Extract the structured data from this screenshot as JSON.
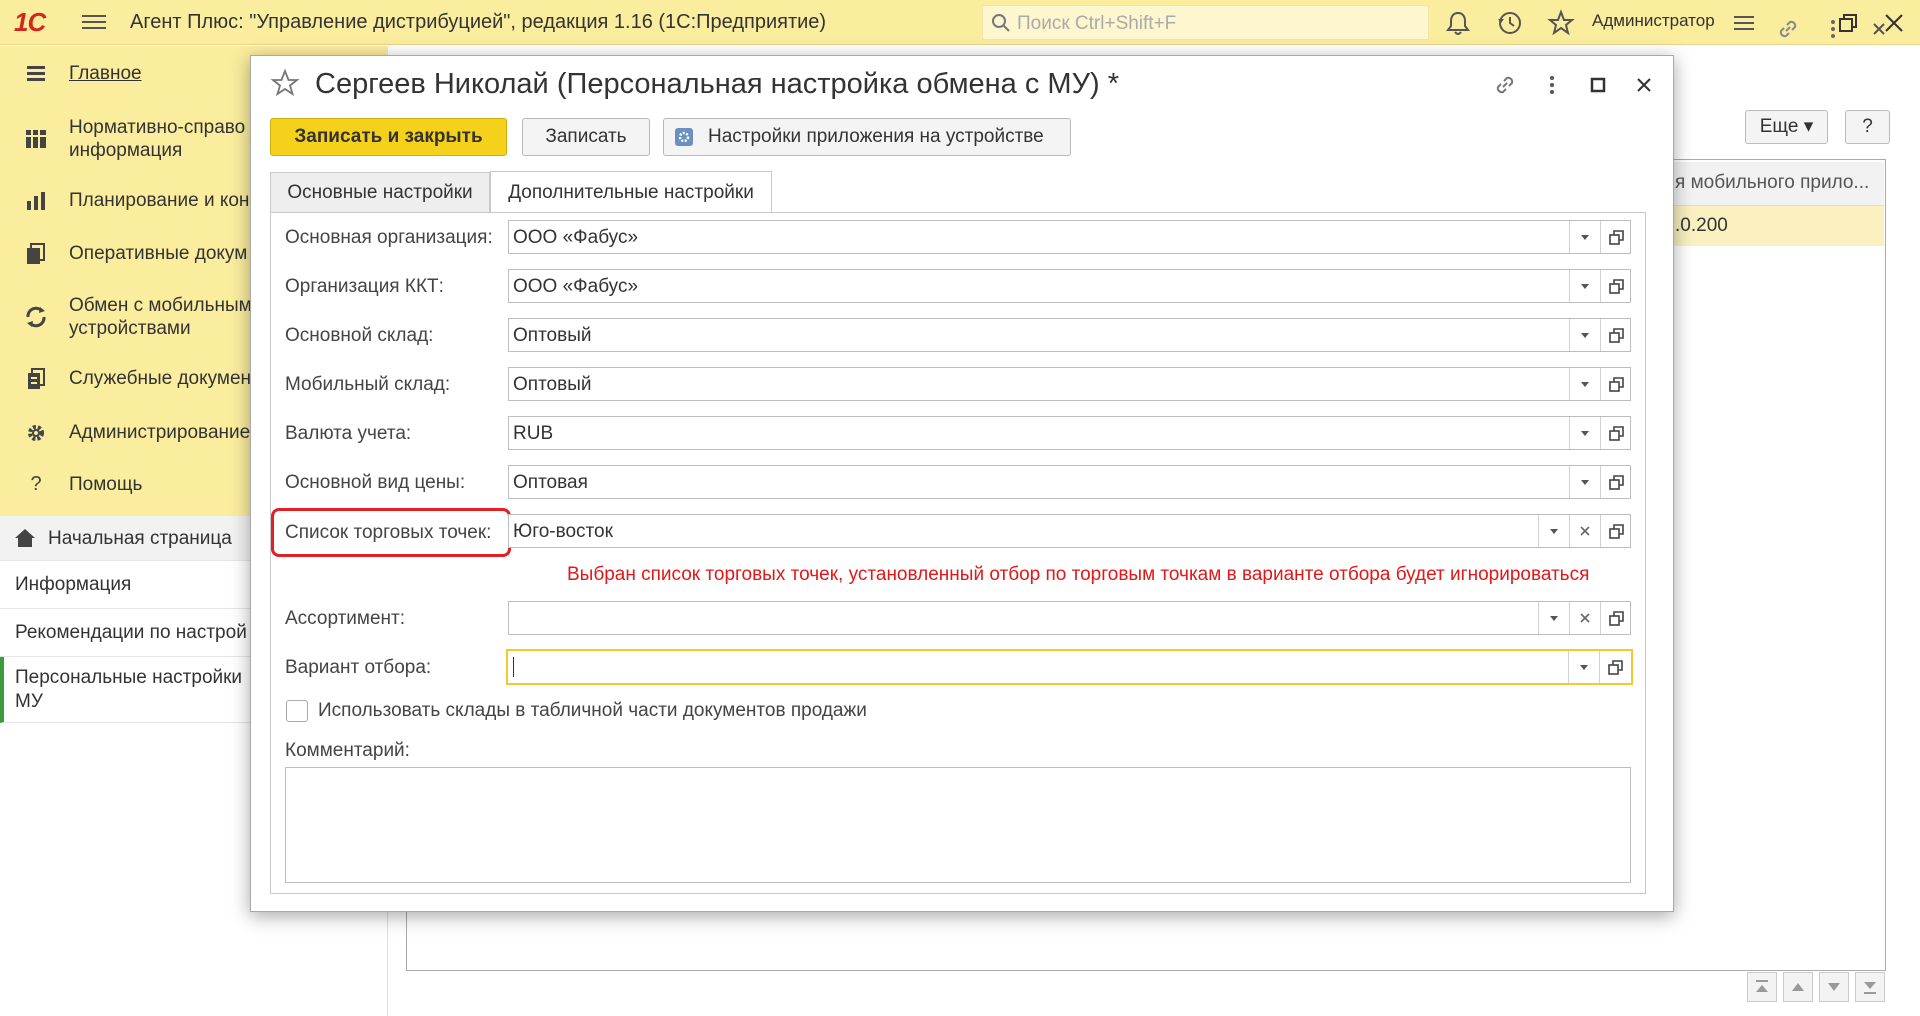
{
  "app": {
    "logo": "1С",
    "title": "Агент Плюс: \"Управление дистрибуцией\", редакция 1.16  (1С:Предприятие)",
    "search_placeholder": "Поиск Ctrl+Shift+F",
    "user": "Администратор",
    "toolbar_icons": [
      "bell-icon",
      "history-icon",
      "star-icon",
      "settings-menu-icon",
      "restore-window-icon",
      "close-icon"
    ]
  },
  "sidebar": {
    "items": [
      {
        "label": "Главное",
        "icon": "menu-lines-icon"
      },
      {
        "label": "Нормативно-справо информация",
        "icon": "grid-icon"
      },
      {
        "label": "Планирование и кон",
        "icon": "bar-chart-icon"
      },
      {
        "label": "Оперативные докум",
        "icon": "documents-icon"
      },
      {
        "label": "Обмен с мобильным устройствами",
        "icon": "sync-icon"
      },
      {
        "label": "Служебные докумен",
        "icon": "service-docs-icon"
      },
      {
        "label": "Администрирование",
        "icon": "gear-icon"
      },
      {
        "label": "Помощь",
        "icon": "question-icon"
      }
    ]
  },
  "nav": {
    "items": [
      {
        "label": "Начальная страница"
      },
      {
        "label": "Информация"
      },
      {
        "label": "Рекомендации по настрой"
      },
      {
        "label": "Персональные настройки МУ"
      }
    ]
  },
  "background_form": {
    "more_button": "Еще",
    "help_button": "?",
    "column_header": "я мобильного прило...",
    "cell_value": ".0.200"
  },
  "dialog": {
    "title": "Сергеев Николай (Персональная настройка обмена с МУ) *",
    "buttons": {
      "save_close": "Записать и закрыть",
      "save": "Записать",
      "device_settings": "Настройки приложения на устройстве"
    },
    "tabs": [
      {
        "label": "Основные настройки",
        "active": false
      },
      {
        "label": "Дополнительные настройки",
        "active": true
      }
    ],
    "fields": [
      {
        "label": "Основная организация:",
        "value": "ООО «Фабус»"
      },
      {
        "label": "Организация ККТ:",
        "value": "ООО «Фабус»"
      },
      {
        "label": "Основной склад:",
        "value": "Оптовый"
      },
      {
        "label": "Мобильный склад:",
        "value": "Оптовый"
      },
      {
        "label": "Валюта учета:",
        "value": "RUB"
      },
      {
        "label": "Основной вид цены:",
        "value": "Оптовая"
      },
      {
        "label": "Список торговых точек:",
        "value": "Юго-восток"
      },
      {
        "label": "Ассортимент:",
        "value": ""
      },
      {
        "label": "Вариант отбора:",
        "value": ""
      }
    ],
    "warning": "Выбран список торговых точек, установленный отбор по торговым точкам в варианте отбора будет игнорироваться",
    "checkbox_label": "Использовать склады в табличной части документов продажи",
    "checkbox_checked": false,
    "comment_label": "Комментарий:",
    "comment_value": ""
  },
  "colors": {
    "top_bar": "#FBED9E",
    "primary_button": "#F5D11B",
    "highlight": "#e31e24",
    "warning_text": "#e01818",
    "active_nav": "#3d9a3d"
  }
}
